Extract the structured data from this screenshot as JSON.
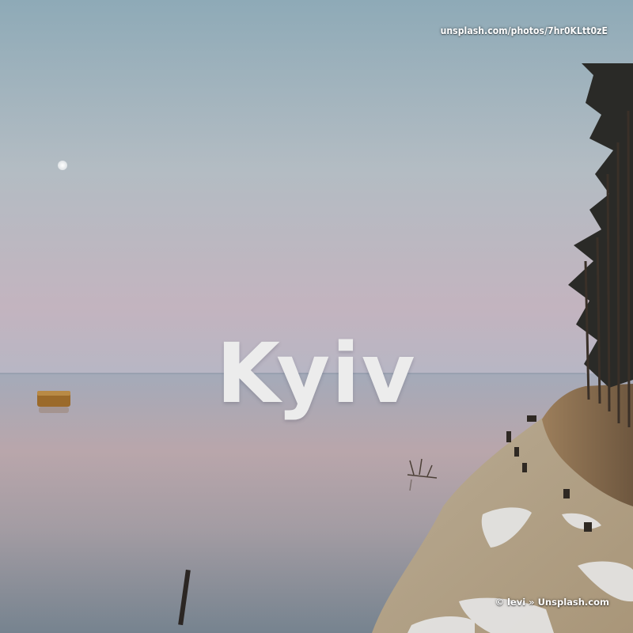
{
  "photo": {
    "url_text": "unsplash.com/photos/7hr0KLtt0zE",
    "credit_text": "© levi » Unsplash.com",
    "title": "Kyiv"
  },
  "scene": {
    "elements": [
      "sky-icon",
      "moon-icon",
      "water-icon",
      "rock-icon",
      "post-icon",
      "driftwood-icon",
      "beach-icon",
      "cliff-icon",
      "pine-trees-icon"
    ],
    "colors": {
      "sky_top": "#93aeb9",
      "sky_mid": "#b6bec4",
      "sky_horizon": "#c4b3bd",
      "water_top": "#a9acba",
      "water_mid": "#b9a3a5",
      "water_bottom": "#7f8b97",
      "sand": "#c4b49a",
      "cliff": "#8d7050",
      "trees": "#2b2a28"
    }
  }
}
